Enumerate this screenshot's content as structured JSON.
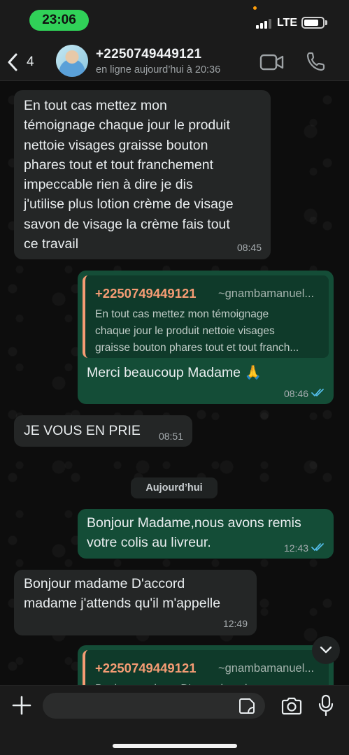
{
  "status_bar": {
    "time": "23:06",
    "network": "LTE"
  },
  "header": {
    "back_count": "4",
    "contact_name": "+2250749449121",
    "contact_status": "en ligne aujourd’hui à 20:36"
  },
  "messages": [
    {
      "direction": "incoming",
      "lines": [
        "En tout cas mettez mon",
        "témoignage chaque jour le produit",
        "nettoie visages graisse bouton",
        "phares tout et tout franchement",
        "impeccable rien à dire je dis",
        "j'utilise plus lotion crème de visage",
        "savon de visage la crème fais tout",
        "ce travail"
      ],
      "time": "08:45"
    },
    {
      "direction": "outgoing",
      "quote": {
        "name": "+2250749449121",
        "handle": "~gnambamanuel...",
        "lines": [
          "En tout cas mettez mon témoignage",
          "chaque jour le produit nettoie visages",
          "graisse bouton phares tout et tout franch..."
        ]
      },
      "text": "Merci beaucoup Madame 🙏",
      "time": "08:46",
      "status": "read"
    },
    {
      "direction": "incoming",
      "text": "JE VOUS EN PRIE",
      "time": "08:51"
    },
    {
      "direction": "outgoing",
      "lines": [
        "Bonjour Madame,nous avons remis",
        "votre colis au livreur."
      ],
      "time": "12:43",
      "status": "read"
    },
    {
      "direction": "incoming",
      "lines": [
        "Bonjour madame D'accord",
        "madame j'attends qu'il m'appelle"
      ],
      "time": "12:49"
    },
    {
      "direction": "outgoing",
      "quote": {
        "name": "+2250749449121",
        "handle": "~gnambamanuel...",
        "lines": [
          "Bonjour madame D'accord madame"
        ]
      }
    }
  ],
  "date_separator": "Aujourd’hui",
  "input": {
    "value": "",
    "placeholder": ""
  },
  "colors": {
    "incoming_bubble": "#242626",
    "outgoing_bubble": "#144d37",
    "quote_accent": "#f59c74",
    "read_ticks": "#53bdeb",
    "time_pill": "#30d158"
  },
  "icons": [
    "back-chevron-icon",
    "video-call-icon",
    "phone-icon",
    "double-check-icon",
    "chevron-down-icon",
    "plus-icon",
    "sticker-icon",
    "camera-icon",
    "microphone-icon"
  ]
}
